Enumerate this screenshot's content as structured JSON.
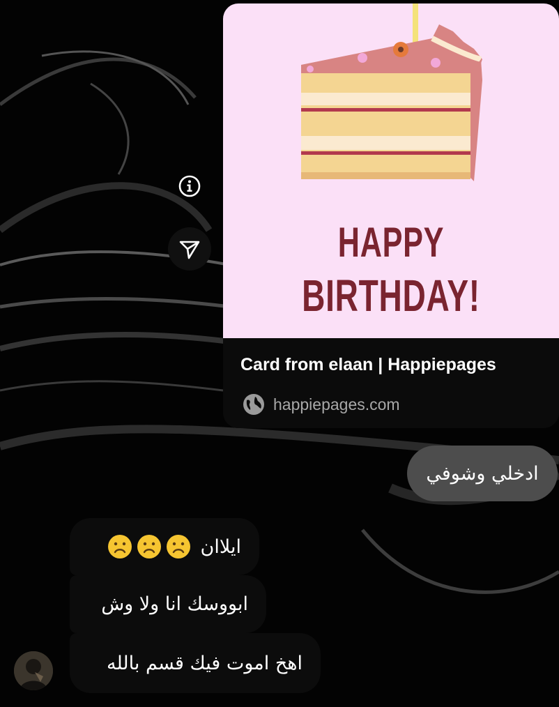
{
  "shared_card": {
    "headline_line1": "HAPPY",
    "headline_line2": "BIRTHDAY!",
    "title": "Card from elaan | Happiepages",
    "domain": "happiepages.com",
    "domain_icon": "globe-icon",
    "image_colors": {
      "background": "#fbe0f7",
      "text": "#7a2430",
      "cake_sponge": "#f4d592",
      "cake_cream": "#fbead0",
      "cake_frosting": "#d88483"
    }
  },
  "actions": {
    "info_icon": "info-icon",
    "send_icon": "send-icon"
  },
  "messages": [
    {
      "direction": "outgoing",
      "text": "ادخلي وشوفي"
    },
    {
      "direction": "incoming",
      "text": "ايلاان",
      "emojis": [
        "frowning-face",
        "frowning-face",
        "frowning-face"
      ]
    },
    {
      "direction": "incoming",
      "text": "ابووسك انا ولا وش"
    },
    {
      "direction": "incoming",
      "text": "اهخ اموت فيك قسم بالله"
    }
  ],
  "colors": {
    "outgoing_bubble": "#4d4d4d",
    "incoming_bubble": "#0c0c0c",
    "emoji_fill": "#f6c531"
  }
}
